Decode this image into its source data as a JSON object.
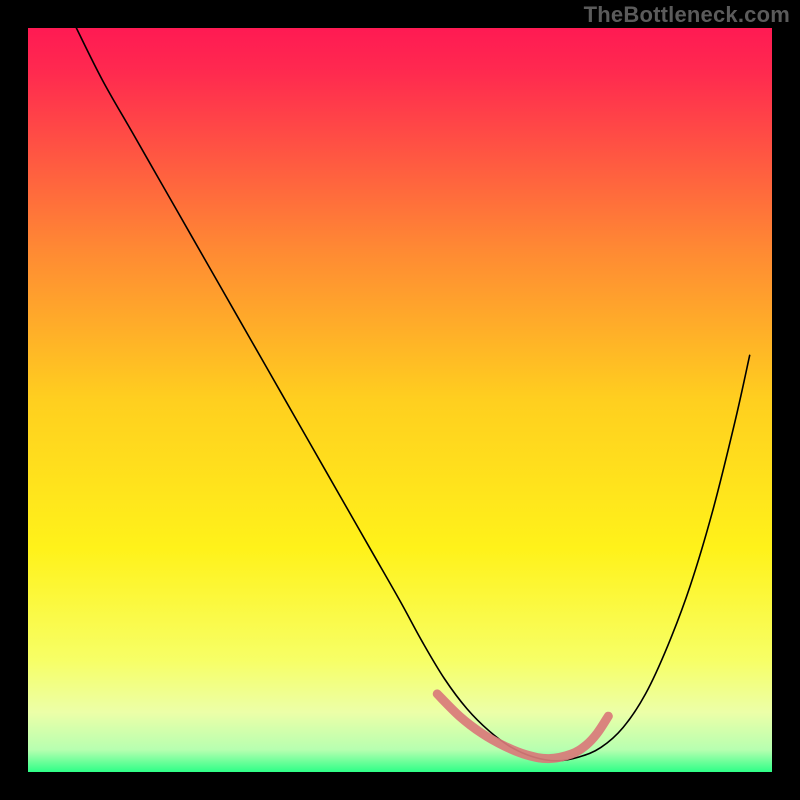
{
  "watermark": "TheBottleneck.com",
  "chart_data": {
    "type": "line",
    "title": "",
    "xlabel": "",
    "ylabel": "",
    "xlim": [
      0,
      100
    ],
    "ylim": [
      0,
      100
    ],
    "grid": false,
    "legend": false,
    "gradient_stops": [
      {
        "offset": 0.0,
        "color": "#ff1a53"
      },
      {
        "offset": 0.06,
        "color": "#ff2a4f"
      },
      {
        "offset": 0.3,
        "color": "#ff8a33"
      },
      {
        "offset": 0.5,
        "color": "#ffcf1f"
      },
      {
        "offset": 0.7,
        "color": "#fff21a"
      },
      {
        "offset": 0.85,
        "color": "#f7ff66"
      },
      {
        "offset": 0.92,
        "color": "#ecffa8"
      },
      {
        "offset": 0.97,
        "color": "#b7ffb0"
      },
      {
        "offset": 1.0,
        "color": "#2eff87"
      }
    ],
    "series": [
      {
        "name": "bottleneck-curve",
        "color": "#000000",
        "width": 1.6,
        "x": [
          6.5,
          10,
          14,
          18,
          22,
          26,
          30,
          34,
          38,
          42,
          46,
          50,
          53,
          56,
          59,
          62,
          65,
          68,
          71,
          74,
          77,
          80,
          83,
          86,
          89,
          92,
          95,
          97
        ],
        "y": [
          100,
          93,
          86,
          79,
          72,
          65,
          58,
          51,
          44,
          37,
          30,
          23,
          17.5,
          12.5,
          8.5,
          5.5,
          3.3,
          2.0,
          1.5,
          2.0,
          3.3,
          6.0,
          10.5,
          17,
          25,
          35,
          47,
          56
        ]
      },
      {
        "name": "highlight-band",
        "color": "#d97a7a",
        "width": 9,
        "linecap": "round",
        "x": [
          55,
          58,
          61,
          64,
          67,
          70,
          73,
          75,
          76.5,
          78
        ],
        "y": [
          10.5,
          7.5,
          5.2,
          3.5,
          2.3,
          1.8,
          2.4,
          3.6,
          5.2,
          7.5
        ]
      }
    ]
  }
}
